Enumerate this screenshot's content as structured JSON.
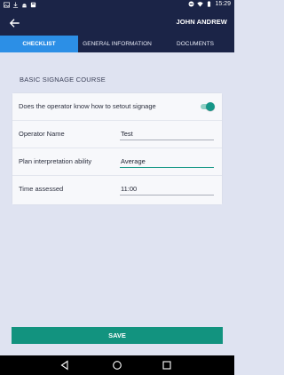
{
  "status_bar": {
    "time": "15:29"
  },
  "app_bar": {
    "title": "JOHN ANDREW",
    "back_icon": "arrow-left-icon"
  },
  "tabs": [
    {
      "label": "CHECKLIST",
      "active": true
    },
    {
      "label": "GENERAL INFORMATION",
      "active": false
    },
    {
      "label": "DOCUMENTS",
      "active": false
    }
  ],
  "section": {
    "title": "BASIC SIGNAGE COURSE"
  },
  "form": {
    "toggle_row": {
      "label": "Does the operator know how to setout signage",
      "checked": true
    },
    "operator_name": {
      "label": "Operator Name",
      "value": "Test"
    },
    "plan_ability": {
      "label": "Plan interpretation ability",
      "value": "Average"
    },
    "time_assessed": {
      "label": "Time assessed",
      "value": "11:00"
    }
  },
  "save_button": {
    "label": "SAVE"
  },
  "colors": {
    "primary_dark": "#1b2447",
    "tab_active": "#2c8fe6",
    "accent": "#12937f",
    "background": "#dfe3f1"
  }
}
